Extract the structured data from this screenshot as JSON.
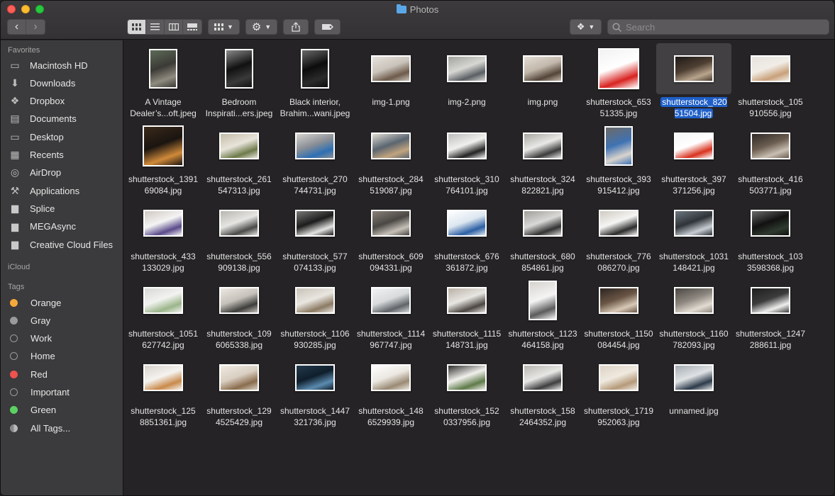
{
  "window": {
    "title": "Photos"
  },
  "toolbar": {
    "search_placeholder": "Search",
    "back_label": "‹",
    "forward_label": "›"
  },
  "sidebar": {
    "favorites_header": "Favorites",
    "favorites": [
      {
        "label": "Macintosh HD",
        "icon": "drive-icon"
      },
      {
        "label": "Downloads",
        "icon": "download-icon"
      },
      {
        "label": "Dropbox",
        "icon": "dropbox-icon"
      },
      {
        "label": "Documents",
        "icon": "document-icon"
      },
      {
        "label": "Desktop",
        "icon": "desktop-icon"
      },
      {
        "label": "Recents",
        "icon": "recents-icon"
      },
      {
        "label": "AirDrop",
        "icon": "airdrop-icon"
      },
      {
        "label": "Applications",
        "icon": "applications-icon"
      },
      {
        "label": "Splice",
        "icon": "folder-icon"
      },
      {
        "label": "MEGAsync",
        "icon": "folder-icon"
      },
      {
        "label": "Creative Cloud Files",
        "icon": "folder-icon"
      }
    ],
    "icloud_header": "iCloud",
    "tags_header": "Tags",
    "tags": [
      {
        "label": "Orange",
        "color": "#f6a93b"
      },
      {
        "label": "Gray",
        "color": "#9a9a9a"
      },
      {
        "label": "Work",
        "color": ""
      },
      {
        "label": "Home",
        "color": ""
      },
      {
        "label": "Red",
        "color": "#f0524e"
      },
      {
        "label": "Important",
        "color": ""
      },
      {
        "label": "Green",
        "color": "#5bd163"
      },
      {
        "label": "All Tags...",
        "color": "all"
      }
    ]
  },
  "files": [
    {
      "label": "A Vintage\nDealer’s...oft.jpeg",
      "colors": [
        "#3b3a35",
        "#8f8b80",
        "#5d6b58"
      ],
      "aspect": "portrait"
    },
    {
      "label": "Bedroom\nInspirati...ers.jpeg",
      "colors": [
        "#111",
        "#3a3a3a",
        "#8a8a8a"
      ],
      "aspect": "portrait"
    },
    {
      "label": "Black interior,\nBrahim...wani.jpeg",
      "colors": [
        "#0c0c0c",
        "#2b2b2b",
        "#6a6a6a"
      ],
      "aspect": "portrait"
    },
    {
      "label": "img-1.png",
      "colors": [
        "#c9c3bb",
        "#6d5a4a",
        "#e5e0da"
      ],
      "aspect": "landscape"
    },
    {
      "label": "img-2.png",
      "colors": [
        "#d7d7d3",
        "#5a5f63",
        "#a0a29c"
      ],
      "aspect": "landscape"
    },
    {
      "label": "img.png",
      "colors": [
        "#c2b7ab",
        "#534538",
        "#e3ddd4"
      ],
      "aspect": "landscape"
    },
    {
      "label": "shutterstock_653\n51335.jpg",
      "colors": [
        "#ffffff",
        "#d8221f",
        "#f2f2f2"
      ],
      "aspect": "square"
    },
    {
      "label": "shutterstock_820\n51504.jpg",
      "colors": [
        "#4e3f32",
        "#b9a58e",
        "#1e1a17"
      ],
      "aspect": "landscape",
      "selected": true
    },
    {
      "label": "shutterstock_105\n910556.jpg",
      "colors": [
        "#f1ede6",
        "#c9a07a",
        "#e6e3df"
      ],
      "aspect": "landscape"
    },
    {
      "label": "shutterstock_1391\n69084.jpg",
      "colors": [
        "#1a1410",
        "#d08a3a",
        "#3b2a1b"
      ],
      "aspect": "square"
    },
    {
      "label": "shutterstock_261\n547313.jpg",
      "colors": [
        "#e8e4da",
        "#6d7a4a",
        "#c4bca9"
      ],
      "aspect": "landscape"
    },
    {
      "label": "shutterstock_270\n744731.jpg",
      "colors": [
        "#8a8f96",
        "#2d6fb3",
        "#d6d3cf"
      ],
      "aspect": "landscape"
    },
    {
      "label": "shutterstock_284\n519087.jpg",
      "colors": [
        "#5a6570",
        "#c2a47e",
        "#e1dcd4"
      ],
      "aspect": "landscape"
    },
    {
      "label": "shutterstock_310\n764101.jpg",
      "colors": [
        "#f0f0ee",
        "#232323",
        "#bdbdbd"
      ],
      "aspect": "landscape"
    },
    {
      "label": "shutterstock_324\n822821.jpg",
      "colors": [
        "#e9e9e7",
        "#3b3b3b",
        "#a8a6a0"
      ],
      "aspect": "landscape"
    },
    {
      "label": "shutterstock_393\n915412.jpg",
      "colors": [
        "#3f72b3",
        "#d9d4cd",
        "#6e6a66"
      ],
      "aspect": "portrait"
    },
    {
      "label": "shutterstock_397\n371256.jpg",
      "colors": [
        "#ffffff",
        "#d8321e",
        "#f5f5f5"
      ],
      "aspect": "landscape"
    },
    {
      "label": "shutterstock_416\n503771.jpg",
      "colors": [
        "#6b5d50",
        "#c9bfb2",
        "#2f2a27"
      ],
      "aspect": "landscape"
    },
    {
      "label": "shutterstock_433\n133029.jpg",
      "colors": [
        "#f4f4f4",
        "#5a4a8a",
        "#d0c8c0"
      ],
      "aspect": "landscape"
    },
    {
      "label": "shutterstock_556\n909138.jpg",
      "colors": [
        "#e5e5e2",
        "#4a4a48",
        "#b8b6b0"
      ],
      "aspect": "landscape"
    },
    {
      "label": "shutterstock_577\n074133.jpg",
      "colors": [
        "#1c1c1c",
        "#e4e4e2",
        "#7a7a78"
      ],
      "aspect": "landscape"
    },
    {
      "label": "shutterstock_609\n094331.jpg",
      "colors": [
        "#4a4744",
        "#c7c1b8",
        "#8a8178"
      ],
      "aspect": "landscape"
    },
    {
      "label": "shutterstock_676\n361872.jpg",
      "colors": [
        "#dce6f0",
        "#2b5fa3",
        "#ffffff"
      ],
      "aspect": "landscape"
    },
    {
      "label": "shutterstock_680\n854861.jpg",
      "colors": [
        "#d9d9d7",
        "#323232",
        "#a09e99"
      ],
      "aspect": "landscape"
    },
    {
      "label": "shutterstock_776\n086270.jpg",
      "colors": [
        "#f5f5f3",
        "#2c2c2c",
        "#cfcac2"
      ],
      "aspect": "landscape"
    },
    {
      "label": "shutterstock_1031\n148421.jpg",
      "colors": [
        "#2e3338",
        "#c8ced4",
        "#6f7880"
      ],
      "aspect": "landscape"
    },
    {
      "label": "shutterstock_103\n3598368.jpg",
      "colors": [
        "#111",
        "#2f3a2f",
        "#6b6b6b"
      ],
      "aspect": "landscape"
    },
    {
      "label": "shutterstock_1051\n627742.jpg",
      "colors": [
        "#f2f3f1",
        "#9bb58a",
        "#d8d9d6"
      ],
      "aspect": "landscape"
    },
    {
      "label": "shutterstock_109\n6065338.jpg",
      "colors": [
        "#c6c2bb",
        "#3d3d3b",
        "#ece8e2"
      ],
      "aspect": "landscape"
    },
    {
      "label": "shutterstock_1106\n930285.jpg",
      "colors": [
        "#e9e6e0",
        "#8b7a63",
        "#c8c2b8"
      ],
      "aspect": "landscape"
    },
    {
      "label": "shutterstock_1114\n967747.jpg",
      "colors": [
        "#d8dadc",
        "#606468",
        "#f2f2f2"
      ],
      "aspect": "landscape"
    },
    {
      "label": "shutterstock_1115\n148731.jpg",
      "colors": [
        "#e8e6e2",
        "#4b4640",
        "#b8b0a6"
      ],
      "aspect": "landscape"
    },
    {
      "label": "shutterstock_1123\n464158.jpg",
      "colors": [
        "#f4f4f4",
        "#5b5b5b",
        "#d6d3ce"
      ],
      "aspect": "portrait"
    },
    {
      "label": "shutterstock_1150\n084454.jpg",
      "colors": [
        "#6b5646",
        "#d8c9b6",
        "#2c2520"
      ],
      "aspect": "landscape"
    },
    {
      "label": "shutterstock_1160\n782093.jpg",
      "colors": [
        "#8d8780",
        "#e2dcd2",
        "#4a4641"
      ],
      "aspect": "landscape"
    },
    {
      "label": "shutterstock_1247\n288611.jpg",
      "colors": [
        "#3c3c3c",
        "#efefee",
        "#1d1d1d"
      ],
      "aspect": "landscape"
    },
    {
      "label": "shutterstock_125\n8851361.jpg",
      "colors": [
        "#f5f3f0",
        "#c98a4a",
        "#d7d2cb"
      ],
      "aspect": "landscape"
    },
    {
      "label": "shutterstock_129\n4525429.jpg",
      "colors": [
        "#d9cfc2",
        "#8a6c4d",
        "#efe9e1"
      ],
      "aspect": "landscape"
    },
    {
      "label": "shutterstock_1447\n321736.jpg",
      "colors": [
        "#0f1e2b",
        "#5b8bb0",
        "#243a4d"
      ],
      "aspect": "landscape"
    },
    {
      "label": "shutterstock_148\n6529939.jpg",
      "colors": [
        "#ebe7e1",
        "#9a8a74",
        "#ffffff"
      ],
      "aspect": "landscape"
    },
    {
      "label": "shutterstock_152\n0337956.jpg",
      "colors": [
        "#f1f0ec",
        "#5f7a4a",
        "#2d2d2d"
      ],
      "aspect": "landscape"
    },
    {
      "label": "shutterstock_158\n2464352.jpg",
      "colors": [
        "#e7e7e5",
        "#3e3e3e",
        "#b7b5b0"
      ],
      "aspect": "landscape"
    },
    {
      "label": "shutterstock_1719\n952063.jpg",
      "colors": [
        "#efe9df",
        "#b59a7a",
        "#ddd3c5"
      ],
      "aspect": "landscape"
    },
    {
      "label": "unnamed.jpg",
      "colors": [
        "#dfe2e4",
        "#2c3a4a",
        "#a3abb2"
      ],
      "aspect": "landscape"
    }
  ]
}
